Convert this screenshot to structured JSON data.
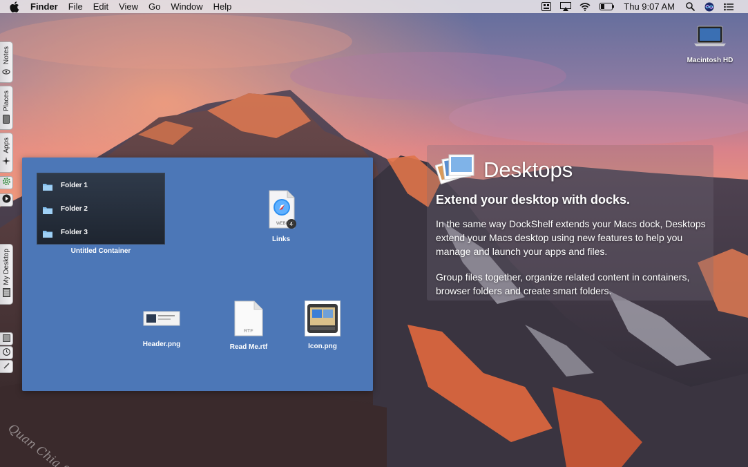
{
  "menubar": {
    "app_name": "Finder",
    "menus": [
      "File",
      "Edit",
      "View",
      "Go",
      "Window",
      "Help"
    ],
    "clock": "Thu 9:07 AM",
    "status_icons": [
      "keyboard-viewer-icon",
      "airplay-icon",
      "wifi-icon",
      "battery-icon",
      "spotlight-icon",
      "siri-icon",
      "notification-center-icon"
    ]
  },
  "side_dock": {
    "tabs": [
      {
        "label": "Notes",
        "icon": "paperclip-icon"
      },
      {
        "label": "Places",
        "icon": "drive-icon"
      },
      {
        "label": "Apps",
        "icon": "launch-icon"
      },
      {
        "label": "My Desktop",
        "icon": "desktop-icon"
      }
    ],
    "buttons": [
      "gear-icon",
      "arrow-right-icon",
      "grid-icon",
      "clock-icon",
      "link-icon"
    ]
  },
  "desktop": {
    "drive_label": "Macintosh HD"
  },
  "panel": {
    "container": {
      "folders": [
        "Folder 1",
        "Folder 2",
        "Folder 3"
      ],
      "caption": "Untitled Container"
    },
    "files": {
      "links": {
        "label": "Links",
        "badge": "4",
        "icon_text": "WEBLOC"
      },
      "header": {
        "label": "Header.png"
      },
      "readme": {
        "label": "Read Me.rtf",
        "icon_text": "RTF"
      },
      "icon": {
        "label": "Icon.png"
      }
    }
  },
  "promo": {
    "title": "Desktops",
    "headline": "Extend your desktop with docks.",
    "paragraph1": "In the same way DockShelf extends your Macs dock, Desktops extend your Macs desktop using new features to help you manage and launch your apps and files.",
    "paragraph2": "Group files together, organize related content in containers, browser folders and create smart folders."
  },
  "watermark": "Quan Chia Soft",
  "colors": {
    "panel": "#4c77b7",
    "container": "#1e2530",
    "sky_top": "#6c7aa8",
    "sky_glow": "#f08a6a"
  }
}
